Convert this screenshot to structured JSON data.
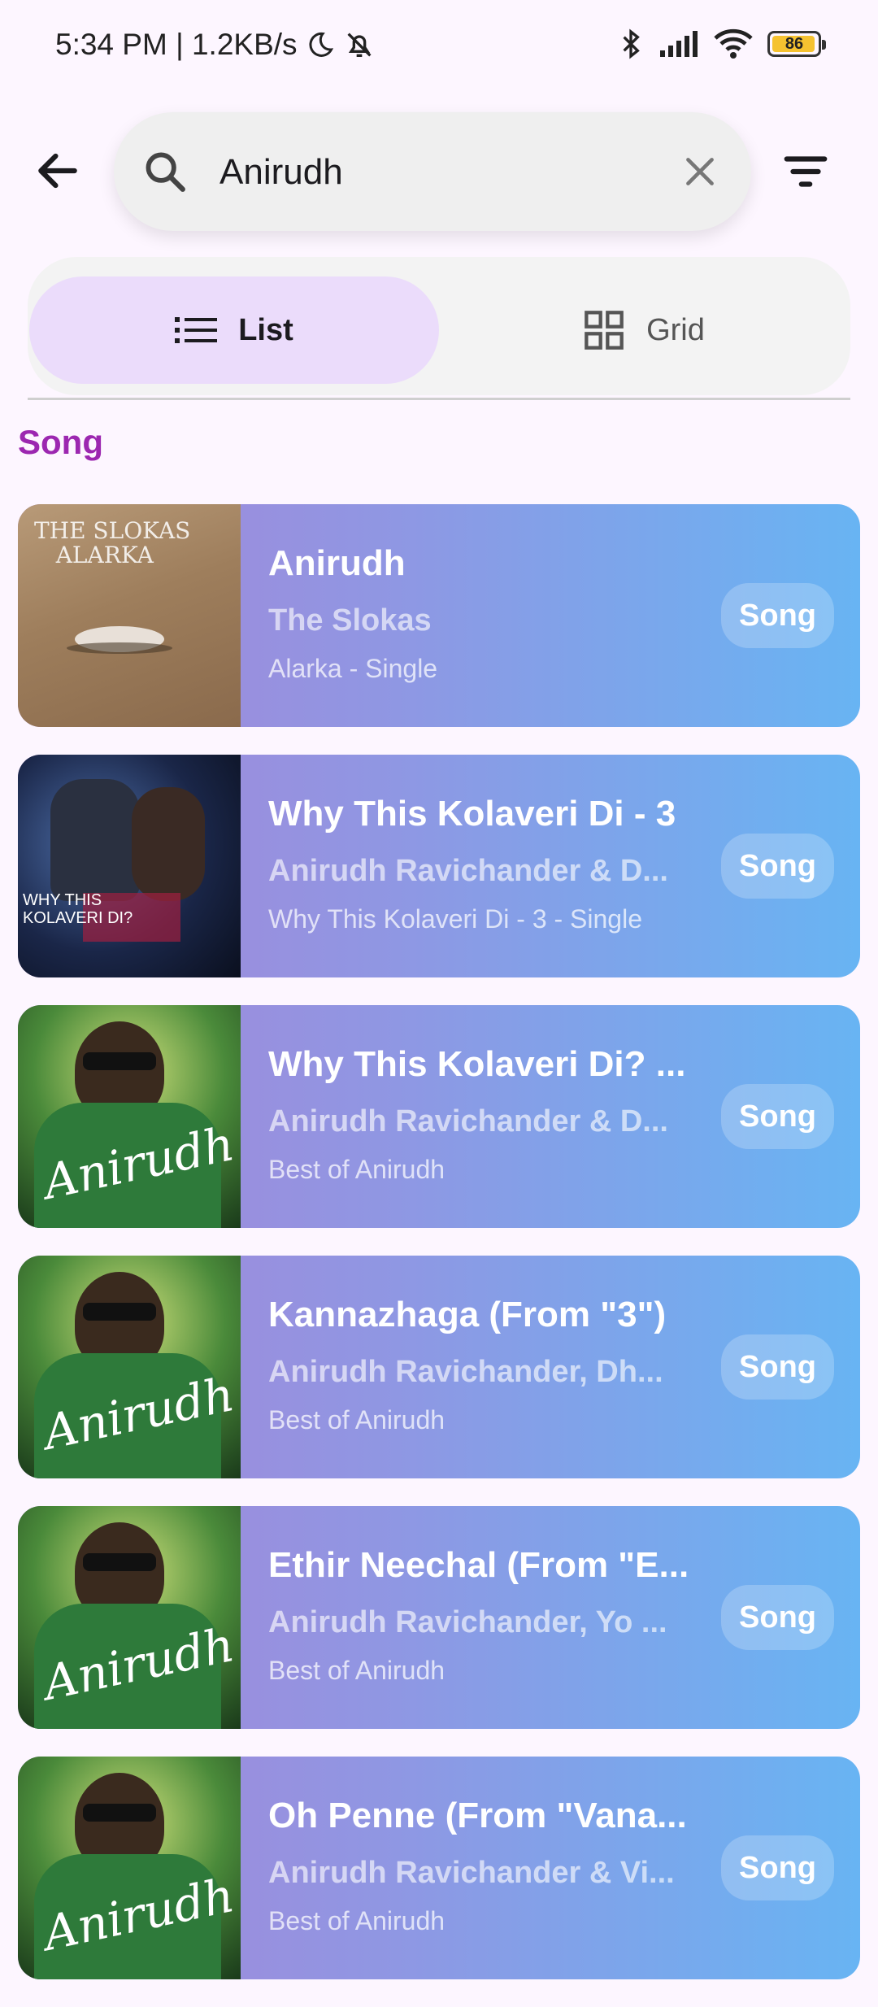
{
  "status_bar": {
    "time_info": "5:34 PM | 1.2KB/s",
    "battery": "86"
  },
  "search": {
    "value": "Anirudh",
    "back_icon": "arrow-left-icon",
    "search_icon": "search-icon",
    "clear_icon": "close-icon",
    "filter_icon": "filter-icon"
  },
  "view_toggle": {
    "list_label": "List",
    "grid_label": "Grid",
    "selected": "List"
  },
  "section": {
    "title": "Song"
  },
  "colors": {
    "accent": "#9c27b0",
    "card_start": "#a685d8",
    "card_end": "#68b4f3",
    "toggle_selected": "#ebdcfb",
    "background": "#fdf6ff"
  },
  "results": [
    {
      "title": "Anirudh",
      "artist": "The Slokas",
      "album": "Alarka - Single",
      "type": "Song",
      "art_text": "THE SLOKAS ALARKA"
    },
    {
      "title": "Why This Kolaveri Di - 3",
      "artist": "Anirudh Ravichander & D...",
      "album": "Why This Kolaveri Di - 3 - Single",
      "type": "Song",
      "art_text": "WHY THIS KOLAVERI DI?"
    },
    {
      "title": "Why This Kolaveri Di? ...",
      "artist": "Anirudh Ravichander & D...",
      "album": "Best of Anirudh",
      "type": "Song",
      "art_text": "Best of Anirudh"
    },
    {
      "title": "Kannazhaga (From \"3\")",
      "artist": "Anirudh Ravichander, Dh...",
      "album": "Best of Anirudh",
      "type": "Song",
      "art_text": "Best of Anirudh"
    },
    {
      "title": "Ethir Neechal (From \"E...",
      "artist": "Anirudh Ravichander, Yo ...",
      "album": "Best of Anirudh",
      "type": "Song",
      "art_text": "Best of Anirudh"
    },
    {
      "title": "Oh Penne (From \"Vana...",
      "artist": "Anirudh Ravichander & Vi...",
      "album": "Best of Anirudh",
      "type": "Song",
      "art_text": "Best of Anirudh"
    }
  ]
}
